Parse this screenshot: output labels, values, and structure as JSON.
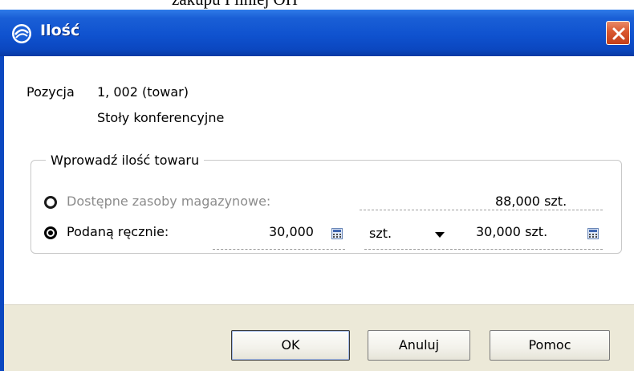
{
  "page_caption": "zakupu I ilniej OH",
  "window": {
    "title": "Ilość",
    "icon": "app-logo-icon",
    "close_icon": "close-icon"
  },
  "position": {
    "label": "Pozycja",
    "number": "1, 002 (towar)",
    "name": "Stoły konferencyjne"
  },
  "quantity_group": {
    "legend": "Wprowadź ilość towaru",
    "option_stock": {
      "label": "Dostępne zasoby magazynowe:",
      "value": "88,000 szt.",
      "selected": false,
      "enabled": false
    },
    "option_manual": {
      "label": "Podaną ręcznie:",
      "selected": true,
      "quantity_value": "30,000",
      "unit_value": "szt.",
      "converted_value": "30,000 szt."
    }
  },
  "buttons": {
    "ok": "OK",
    "cancel": "Anuluj",
    "help": "Pomoc"
  },
  "colors": {
    "titlebar": "#0b47c0",
    "close_button": "#d9572f",
    "footer": "#ece9d8",
    "disabled_text": "#8c8c8c"
  }
}
